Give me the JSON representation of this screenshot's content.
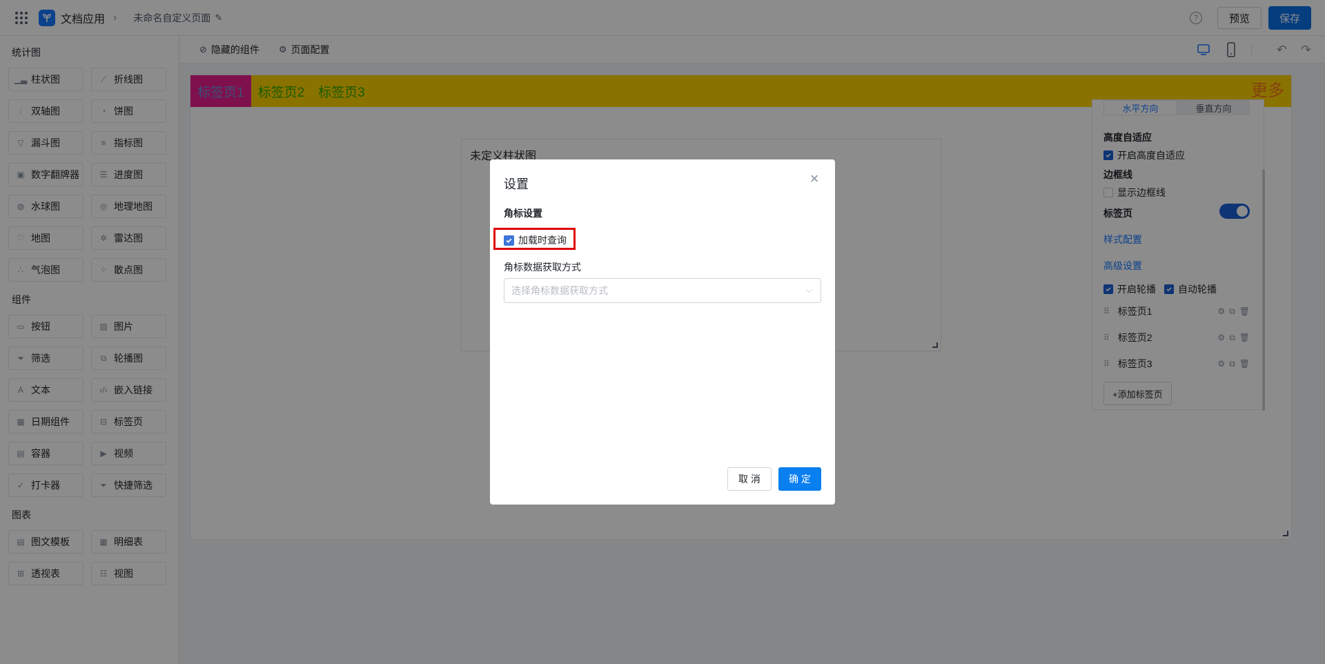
{
  "header": {
    "app_name": "文档应用",
    "page_name": "未命名自定义页面",
    "preview_label": "预览",
    "save_label": "保存",
    "help_symbol": "?"
  },
  "toolbar": {
    "hidden_components_label": "隐藏的组件",
    "page_config_label": "页面配置"
  },
  "sidebar": {
    "groups": [
      {
        "title": "统计图",
        "items": [
          {
            "label": "柱状图",
            "icon": "bar-chart-icon"
          },
          {
            "label": "折线图",
            "icon": "line-chart-icon"
          },
          {
            "label": "双轴图",
            "icon": "dual-axis-chart-icon"
          },
          {
            "label": "饼图",
            "icon": "pie-chart-icon"
          },
          {
            "label": "漏斗图",
            "icon": "funnel-chart-icon"
          },
          {
            "label": "指标图",
            "icon": "indicator-chart-icon"
          },
          {
            "label": "数字翻牌器",
            "icon": "number-flipper-icon"
          },
          {
            "label": "进度图",
            "icon": "progress-chart-icon"
          },
          {
            "label": "水球图",
            "icon": "liquid-chart-icon"
          },
          {
            "label": "地理地图",
            "icon": "geo-map-icon"
          },
          {
            "label": "地图",
            "icon": "map-icon"
          },
          {
            "label": "雷达图",
            "icon": "radar-chart-icon"
          },
          {
            "label": "气泡图",
            "icon": "bubble-chart-icon"
          },
          {
            "label": "散点图",
            "icon": "scatter-chart-icon"
          }
        ]
      },
      {
        "title": "组件",
        "items": [
          {
            "label": "按钮",
            "icon": "button-icon"
          },
          {
            "label": "图片",
            "icon": "image-icon"
          },
          {
            "label": "筛选",
            "icon": "filter-icon"
          },
          {
            "label": "轮播图",
            "icon": "carousel-icon"
          },
          {
            "label": "文本",
            "icon": "text-icon"
          },
          {
            "label": "嵌入链接",
            "icon": "embed-link-icon"
          },
          {
            "label": "日期组件",
            "icon": "date-icon"
          },
          {
            "label": "标签页",
            "icon": "tabs-icon"
          },
          {
            "label": "容器",
            "icon": "container-icon"
          },
          {
            "label": "视频",
            "icon": "video-icon"
          },
          {
            "label": "打卡器",
            "icon": "check-in-icon"
          },
          {
            "label": "快捷筛选",
            "icon": "quick-filter-icon"
          }
        ]
      },
      {
        "title": "图表",
        "items": [
          {
            "label": "图文模板",
            "icon": "template-icon"
          },
          {
            "label": "明细表",
            "icon": "detail-table-icon"
          },
          {
            "label": "透视表",
            "icon": "pivot-table-icon"
          },
          {
            "label": "视图",
            "icon": "view-icon"
          }
        ]
      }
    ]
  },
  "canvas": {
    "tabs": [
      "标签页1",
      "标签页2",
      "标签页3"
    ],
    "more_label": "更多",
    "chart_title": "未定义柱状图"
  },
  "config_panel": {
    "direction_options": [
      "水平方向",
      "垂直方向"
    ],
    "height_adaptive_label": "高度自适应",
    "height_adaptive_check": "开启高度自适应",
    "border_label": "边框线",
    "border_check": "显示边框线",
    "tabs_label": "标签页",
    "style_config_link": "样式配置",
    "advanced_link": "高级设置",
    "carousel_check": "开启轮播",
    "auto_carousel_check": "自动轮播",
    "tab_items": [
      "标签页1",
      "标签页2",
      "标签页3"
    ],
    "add_tab_label": "+添加标签页"
  },
  "modal": {
    "title": "设置",
    "section_title": "角标设置",
    "load_query_label": "加载时查询",
    "load_query_checked": true,
    "fetch_mode_label": "角标数据获取方式",
    "fetch_mode_placeholder": "选择角标数据获取方式",
    "cancel_label": "取 消",
    "ok_label": "确 定"
  },
  "colors": {
    "primary": "#0a6fe8",
    "tabbar_bg": "#fbd000",
    "tab_active_bg": "#e5208c",
    "tab_text": "#2ea600",
    "more_text": "#f07a1a",
    "highlight_border": "#e00000"
  }
}
